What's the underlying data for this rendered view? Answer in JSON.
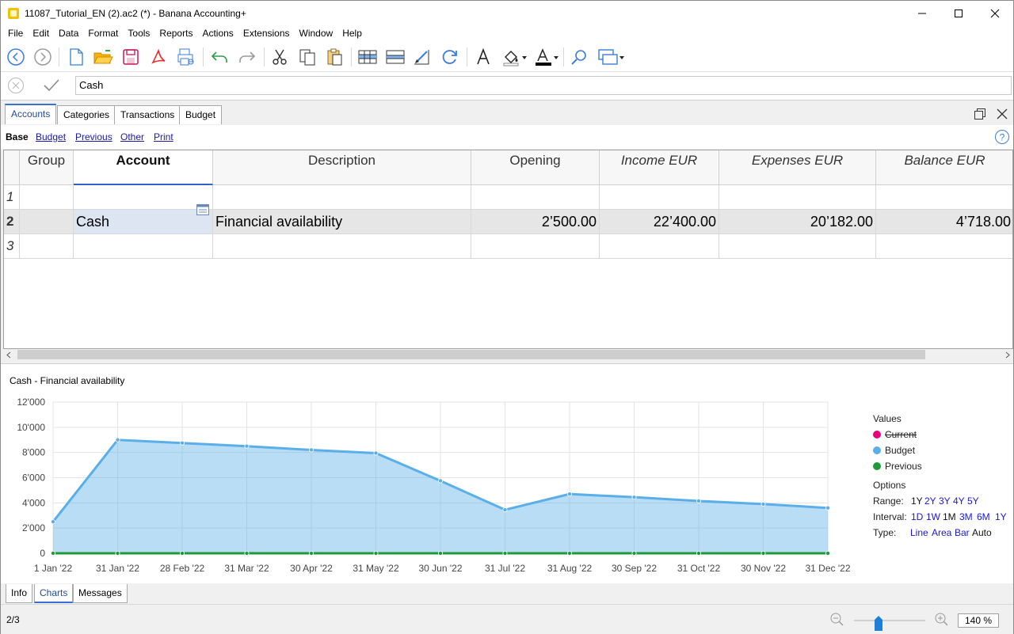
{
  "window": {
    "title": "11087_Tutorial_EN (2).ac2 (*) - Banana Accounting+"
  },
  "menu": [
    "File",
    "Edit",
    "Data",
    "Format",
    "Tools",
    "Reports",
    "Actions",
    "Extensions",
    "Window",
    "Help"
  ],
  "formula_bar": {
    "value": "Cash"
  },
  "table_tabs": [
    "Accounts",
    "Categories",
    "Transactions",
    "Budget"
  ],
  "views": [
    "Base",
    "Budget",
    "Previous",
    "Other",
    "Print"
  ],
  "grid": {
    "columns": [
      "Group",
      "Account",
      "Description",
      "Opening",
      "Income EUR",
      "Expenses EUR",
      "Balance EUR"
    ],
    "rows": [
      {
        "num": "1",
        "group": "",
        "account": "",
        "description": "",
        "opening": "",
        "income": "",
        "expenses": "",
        "balance": ""
      },
      {
        "num": "2",
        "group": "",
        "account": "Cash",
        "description": "Financial availability",
        "opening": "2’500.00",
        "income": "22’400.00",
        "expenses": "20’182.00",
        "balance": "4’718.00"
      },
      {
        "num": "3",
        "group": "",
        "account": "",
        "description": "",
        "opening": "",
        "income": "",
        "expenses": "",
        "balance": ""
      }
    ]
  },
  "chart_panel": {
    "title": "Cash - Financial availability",
    "legend_title": "Values",
    "legend": [
      {
        "label": "Current",
        "color": "#e6007e",
        "struck": true
      },
      {
        "label": "Budget",
        "color": "#5aaeea",
        "struck": false
      },
      {
        "label": "Previous",
        "color": "#1f9a3a",
        "struck": false
      }
    ],
    "options_title": "Options",
    "range_label": "Range:",
    "range": [
      "1Y",
      "2Y",
      "3Y",
      "4Y",
      "5Y"
    ],
    "interval_label": "Interval:",
    "interval": [
      "1D",
      "1W",
      "1M",
      "3M",
      "6M",
      "1Y"
    ],
    "type_label": "Type:",
    "types": [
      "Line",
      "Area",
      "Bar",
      "Auto"
    ]
  },
  "chart_data": {
    "type": "area",
    "categories": [
      "1 Jan '22",
      "31 Jan '22",
      "28 Feb '22",
      "31 Mar '22",
      "30 Apr '22",
      "31 May '22",
      "30 Jun '22",
      "31 Jul '22",
      "31 Aug '22",
      "30 Sep '22",
      "31 Oct '22",
      "30 Nov '22",
      "31 Dec '22"
    ],
    "yticks": [
      "0",
      "2'000",
      "4'000",
      "6'000",
      "8'000",
      "10'000",
      "12'000"
    ],
    "ylim": [
      0,
      12000
    ],
    "grid": true,
    "legend_position": "right",
    "series": [
      {
        "name": "Budget",
        "color": "#5aaeea",
        "values": [
          2500,
          9000,
          8750,
          8500,
          8200,
          7950,
          5750,
          3450,
          4700,
          4450,
          4150,
          3900,
          3600
        ]
      },
      {
        "name": "Previous",
        "color": "#1f9a3a",
        "values": [
          0,
          0,
          0,
          0,
          0,
          0,
          0,
          0,
          0,
          0,
          0,
          0,
          0
        ]
      }
    ]
  },
  "bottom_tabs": [
    "Info",
    "Charts",
    "Messages"
  ],
  "status": {
    "position": "2/3",
    "zoom": "140 %",
    "zoom_level": 0.35
  }
}
